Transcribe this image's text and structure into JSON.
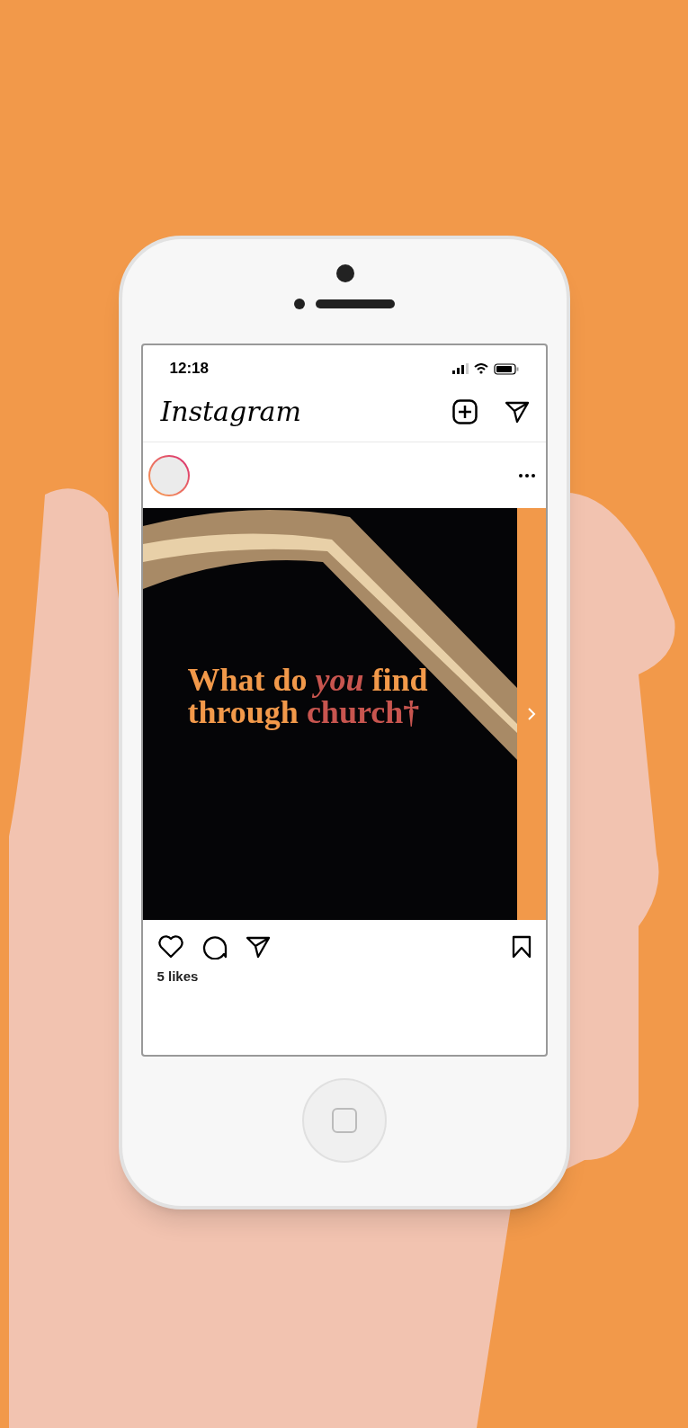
{
  "status_bar": {
    "time": "12:18"
  },
  "header": {
    "logo": "Instagram"
  },
  "post": {
    "headline": [
      {
        "text": "What do ",
        "kind": "plain"
      },
      {
        "text": "you",
        "kind": "accent_italic"
      },
      {
        "text": " find through ",
        "kind": "plain"
      },
      {
        "text": "church†",
        "kind": "accent"
      }
    ],
    "likes": "5 likes"
  }
}
